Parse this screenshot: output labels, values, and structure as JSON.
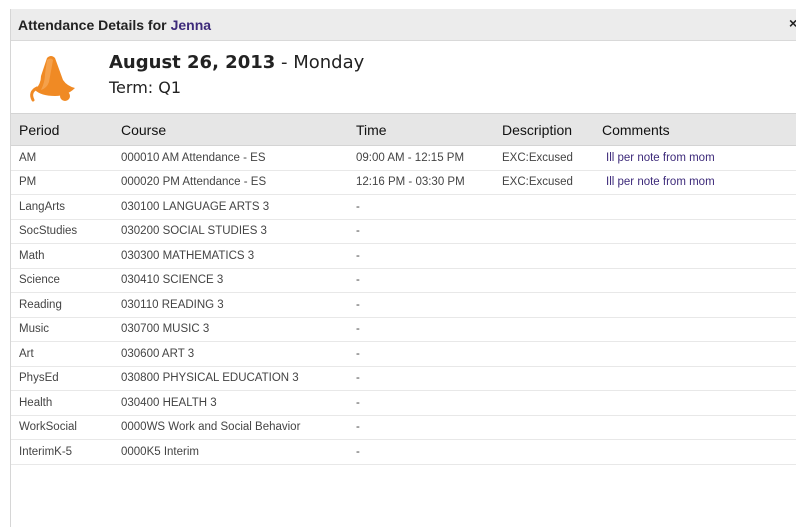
{
  "dialog": {
    "title_prefix": "Attendance Details for",
    "student_name": "Jenna",
    "close_label": "×"
  },
  "header": {
    "date": "August 26, 2013",
    "day": "- Monday",
    "term": "Term: Q1",
    "icon": "bell-icon",
    "icon_color": "#f08a24"
  },
  "table": {
    "columns": [
      "Period",
      "Course",
      "Time",
      "Description",
      "Comments"
    ],
    "rows": [
      {
        "period": "AM",
        "course": "000010 AM Attendance - ES",
        "time": "09:00 AM - 12:15 PM",
        "description": "EXC:Excused",
        "comments": "Ill per note from mom"
      },
      {
        "period": "PM",
        "course": "000020 PM Attendance - ES",
        "time": "12:16 PM - 03:30 PM",
        "description": "EXC:Excused",
        "comments": "Ill per note from mom"
      },
      {
        "period": "LangArts",
        "course": "030100 LANGUAGE ARTS 3",
        "time": "-",
        "description": "",
        "comments": ""
      },
      {
        "period": "SocStudies",
        "course": "030200 SOCIAL STUDIES 3",
        "time": "-",
        "description": "",
        "comments": ""
      },
      {
        "period": "Math",
        "course": "030300 MATHEMATICS 3",
        "time": "-",
        "description": "",
        "comments": ""
      },
      {
        "period": "Science",
        "course": "030410 SCIENCE 3",
        "time": "-",
        "description": "",
        "comments": ""
      },
      {
        "period": "Reading",
        "course": "030110 READING 3",
        "time": "-",
        "description": "",
        "comments": ""
      },
      {
        "period": "Music",
        "course": "030700 MUSIC 3",
        "time": "-",
        "description": "",
        "comments": ""
      },
      {
        "period": "Art",
        "course": "030600 ART 3",
        "time": "-",
        "description": "",
        "comments": ""
      },
      {
        "period": "PhysEd",
        "course": "030800 PHYSICAL EDUCATION 3",
        "time": "-",
        "description": "",
        "comments": ""
      },
      {
        "period": "Health",
        "course": "030400 HEALTH 3",
        "time": "-",
        "description": "",
        "comments": ""
      },
      {
        "period": "WorkSocial",
        "course": "0000WS Work and Social Behavior",
        "time": "-",
        "description": "",
        "comments": ""
      },
      {
        "period": "InterimK-5",
        "course": "0000K5 Interim",
        "time": "-",
        "description": "",
        "comments": ""
      }
    ]
  }
}
